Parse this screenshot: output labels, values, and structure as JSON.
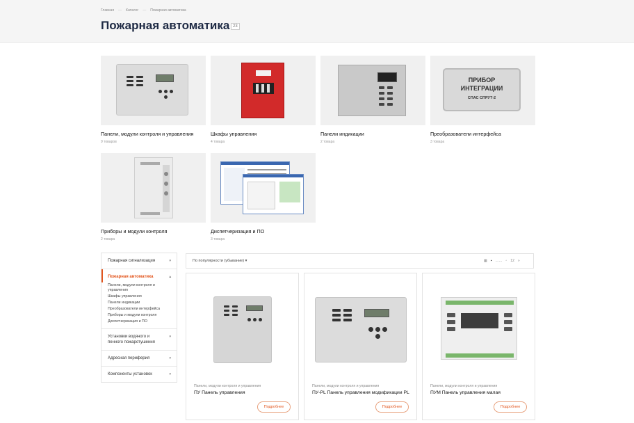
{
  "breadcrumb": [
    "Главная",
    "Каталог",
    "Пожарная автоматика"
  ],
  "page": {
    "title": "Пожарная автоматика",
    "count": "23"
  },
  "categories": [
    {
      "title": "Панели, модули контроля и управления",
      "count": "9 товаров"
    },
    {
      "title": "Шкафы управления",
      "count": "4 товара"
    },
    {
      "title": "Панели индикации",
      "count": "2 товара"
    },
    {
      "title": "Преобразователи интерфейса",
      "count": "3 товара"
    },
    {
      "title": "Приборы и модули контроля",
      "count": "2 товара"
    },
    {
      "title": "Диспетчеризация и ПО",
      "count": "3 товара"
    }
  ],
  "device_text": {
    "integ_line1": "ПРИБОР",
    "integ_line2": "ИНТЕГРАЦИИ",
    "integ_line3": "СПАС СПРУТ-2"
  },
  "sidebar": {
    "items": [
      {
        "label": "Пожарная сигнализация"
      },
      {
        "label": "Пожарная автоматика"
      },
      {
        "label": "Установки водяного и пенного пожаротушения"
      },
      {
        "label": "Адресная периферия"
      },
      {
        "label": "Компоненты установок"
      }
    ],
    "subitems": [
      "Панели, модули контроля и управления",
      "Шкафы управления",
      "Панели индикации",
      "Преобразователи интерфейса",
      "Приборы и модули контроля",
      "Диспетчеризация и ПО"
    ],
    "arrow": "▾"
  },
  "sort": {
    "label": "По популярности (убывание)",
    "arrow": "▾"
  },
  "view": {
    "a": "▦",
    "b": "▪",
    "c": "……",
    "d": "▫",
    "e": "12",
    "f": "»"
  },
  "products": [
    {
      "category": "Панели, модули контроля и управления",
      "title": "ПУ Панель управления",
      "button": "Подробнее"
    },
    {
      "category": "Панели, модули контроля и управления",
      "title": "ПУ-PL Панель управления модификации PL",
      "button": "Подробнее"
    },
    {
      "category": "Панели, модули контроля и управления",
      "title": "ПУМ Панель управления малая",
      "button": "Подробнее"
    }
  ],
  "colors": {
    "accent": "#e3571f",
    "title": "#1e2a44",
    "header_bg": "#f5f5f5"
  }
}
